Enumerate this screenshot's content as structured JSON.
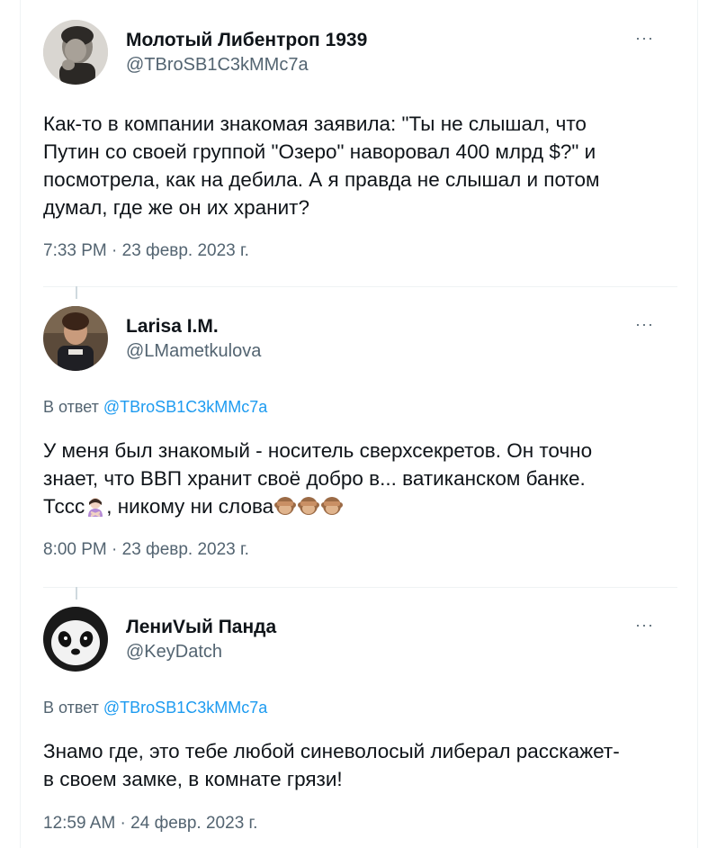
{
  "tweets": [
    {
      "name": "Молотый Либентроп 1939",
      "handle": "@TBroSB1C3kMMc7a",
      "text_lines": [
        "Как-то в компании знакомая заявила: \"Ты не слышал, что",
        "Путин со своей группой \"Озеро\" наворовал 400 млрд $?\" и",
        "посмотрела, как на дебила. А я правда не слышал и потом",
        "думал, где же он их хранит?"
      ],
      "timestamp": "7:33 PM · 23 февр. 2023 г.",
      "more": "···"
    },
    {
      "name": "Larisa I.M.",
      "handle": "@LMametkulova",
      "reply_prefix": "В ответ",
      "reply_to": "@TBroSB1C3kMMc7a",
      "text_lines": [
        "У меня был знакомый - носитель сверхсекретов. Он точно",
        "знает, что ВВП хранит своё добро в... ватиканском банке.",
        "Тссс",
        ", никому ни слова"
      ],
      "timestamp": "8:00 PM · 23 февр. 2023 г.",
      "more": "···"
    },
    {
      "name": "ЛениVый Панда",
      "handle": "@KeyDatch",
      "reply_prefix": "В ответ",
      "reply_to": "@TBroSB1C3kMMc7a",
      "text_lines": [
        "Знамо где, это тебе любой синеволосый либерал расскажет-",
        "в своем замке, в комнате грязи!"
      ],
      "timestamp": "12:59 AM · 24 февр. 2023 г.",
      "more": "···"
    }
  ],
  "icons": {
    "shush": "woman-gesturing-no-icon",
    "monkey": "see-no-evil-monkey-icon"
  },
  "colors": {
    "link": "#1d9bf0",
    "secondary": "#536471",
    "border": "#eff3f4"
  }
}
